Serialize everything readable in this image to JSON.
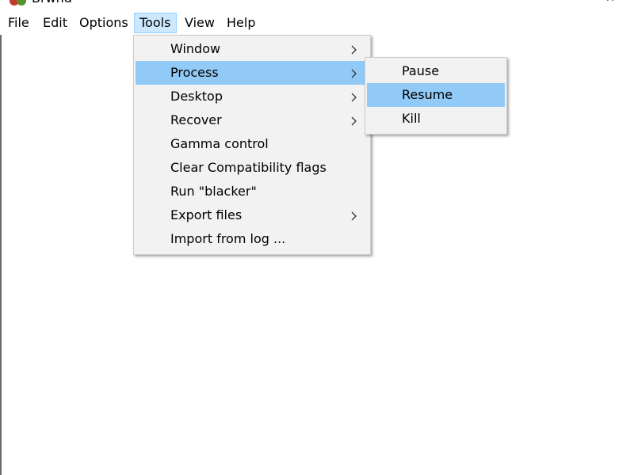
{
  "window": {
    "title": "Brwnd"
  },
  "titlebar": {
    "minimize_glyph": "—",
    "close_glyph": "✕"
  },
  "menubar": {
    "items": [
      {
        "label": "File"
      },
      {
        "label": "Edit"
      },
      {
        "label": "Options"
      },
      {
        "label": "Tools",
        "active": true
      },
      {
        "label": "View"
      },
      {
        "label": "Help"
      }
    ]
  },
  "tools_menu": {
    "items": [
      {
        "label": "Window",
        "submenu": true
      },
      {
        "label": "Process",
        "submenu": true,
        "highlighted": true
      },
      {
        "label": "Desktop",
        "submenu": true
      },
      {
        "label": "Recover",
        "submenu": true
      },
      {
        "label": "Gamma control",
        "submenu": false
      },
      {
        "label": "Clear Compatibility flags",
        "submenu": false
      },
      {
        "label": "Run \"blacker\"",
        "submenu": false
      },
      {
        "label": "Export files",
        "submenu": true
      },
      {
        "label": "Import from log ...",
        "submenu": false
      }
    ]
  },
  "process_submenu": {
    "items": [
      {
        "label": "Pause"
      },
      {
        "label": "Resume",
        "highlighted": true
      },
      {
        "label": "Kill"
      }
    ]
  },
  "colors": {
    "menu_background": "#f2f2f2",
    "highlight": "#91c9f7",
    "menubar_active": "#cce8ff",
    "menubar_active_border": "#99d1ff"
  }
}
